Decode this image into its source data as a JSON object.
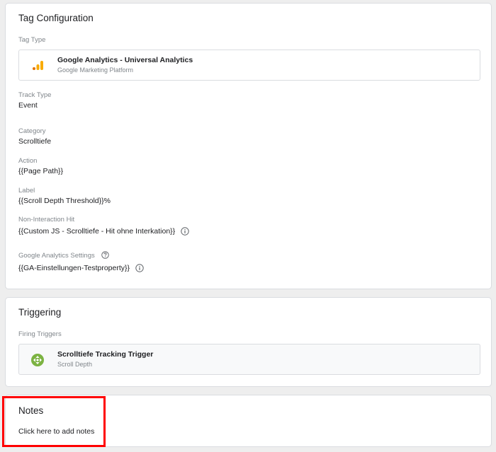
{
  "tag_configuration": {
    "title": "Tag Configuration",
    "tag_type_label": "Tag Type",
    "tag_type_name": "Google Analytics - Universal Analytics",
    "tag_type_provider": "Google Marketing Platform",
    "fields": {
      "track_type": {
        "label": "Track Type",
        "value": "Event"
      },
      "category": {
        "label": "Category",
        "value": "Scrolltiefe"
      },
      "action": {
        "label": "Action",
        "value": "{{Page Path}}"
      },
      "label": {
        "label": "Label",
        "value": "{{Scroll Depth Threshold}}%"
      },
      "non_interaction": {
        "label": "Non-Interaction Hit",
        "value": "{{Custom JS - Scrolltiefe - Hit ohne Interkation}}"
      },
      "ga_settings": {
        "label": "Google Analytics Settings",
        "value": "{{GA-Einstellungen-Testproperty}}"
      }
    }
  },
  "triggering": {
    "title": "Triggering",
    "firing_label": "Firing Triggers",
    "trigger_name": "Scrolltiefe Tracking Trigger",
    "trigger_type": "Scroll Depth"
  },
  "notes": {
    "title": "Notes",
    "add_link": "Click here to add notes"
  },
  "colors": {
    "ga_orange": "#f9ab00",
    "ga_dark_orange": "#e37400",
    "trigger_green": "#7cb342",
    "highlight": "#ff0000"
  },
  "icons": {
    "analytics": "analytics-bars-icon",
    "info": "info-icon",
    "help": "help-icon",
    "scroll": "scroll-depth-icon"
  }
}
